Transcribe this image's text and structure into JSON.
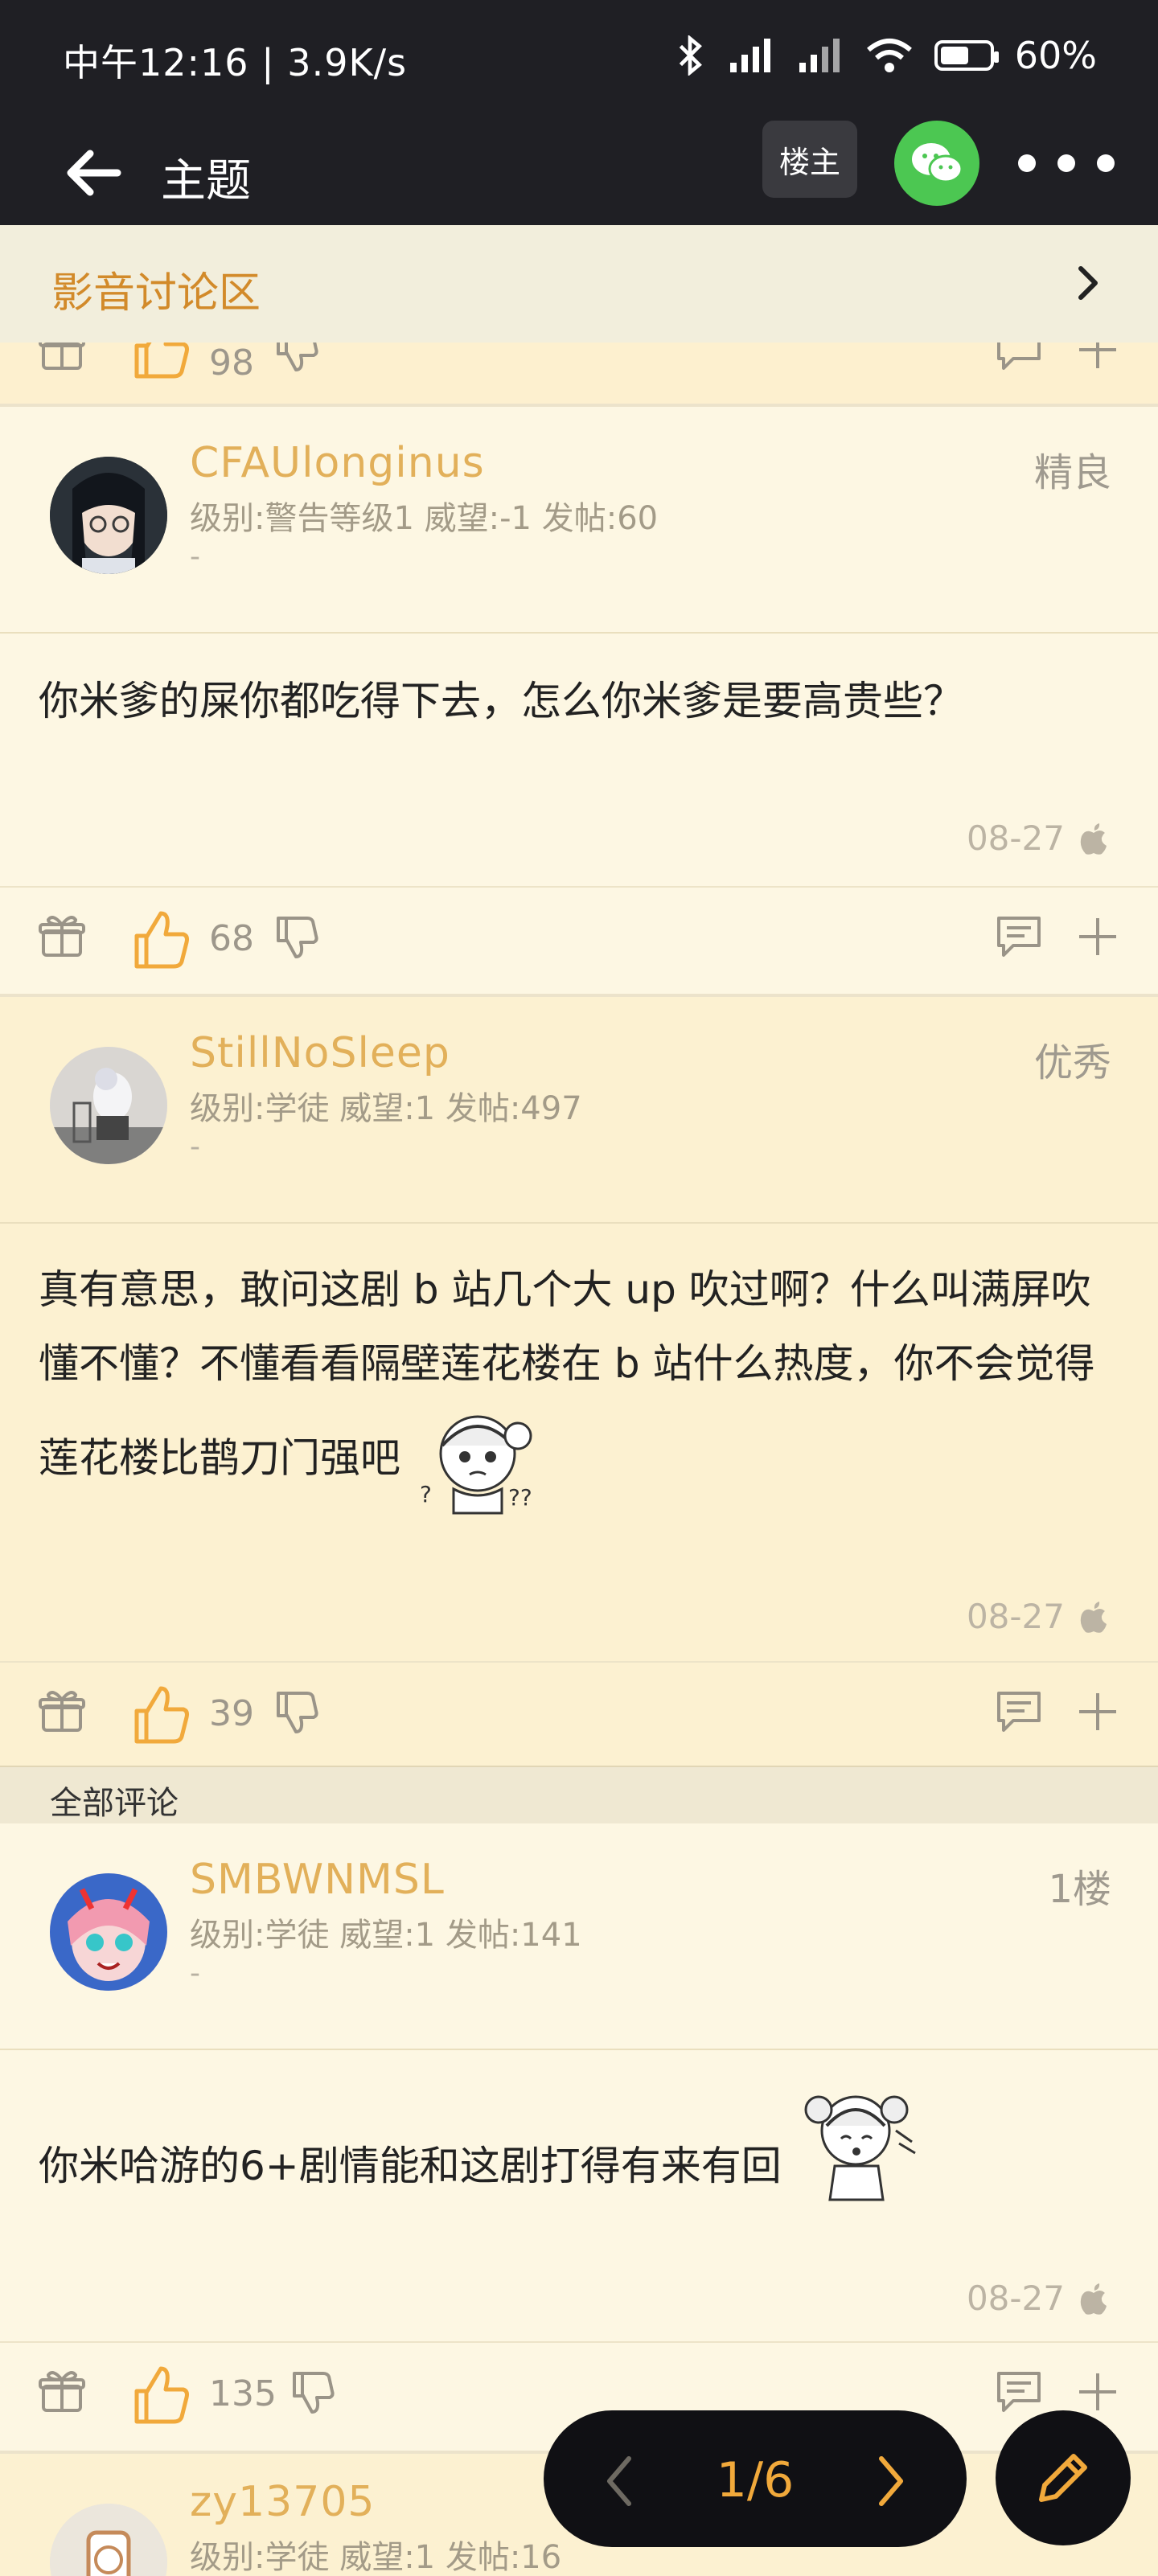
{
  "status_bar": {
    "time": "中午12:16 | 3.9K/s",
    "battery": "60%"
  },
  "header": {
    "title": "主题",
    "op_label": "楼主"
  },
  "forum": {
    "name": "影音讨论区"
  },
  "partial_top": {
    "likes": "98"
  },
  "posts": [
    {
      "username": "CFAUlonginus",
      "meta": "级别:警告等级1 威望:-1 发帖:60",
      "signature": "-",
      "badge": "精良",
      "content": "你米爹的屎你都吃得下去，怎么你米爹是要高贵些？",
      "date": "08-27",
      "likes": "68"
    },
    {
      "username": "StillNoSleep",
      "meta": "级别:学徒 威望:1 发帖:497",
      "signature": "-",
      "badge": "优秀",
      "content": "真有意思，敢问这剧 b 站几个大 up 吹过啊？什么叫满屏吹懂不懂？不懂看看隔壁莲花楼在 b 站什么热度，你不会觉得莲花楼比鹊刀门强吧",
      "date": "08-27",
      "likes": "39"
    },
    {
      "username": "SMBWNMSL",
      "meta": "级别:学徒 威望:1 发帖:141",
      "signature": "-",
      "badge": "1楼",
      "content": "你米哈游的6+剧情能和这剧打得有来有回",
      "date": "08-27",
      "likes": "135"
    },
    {
      "username": "zy13705",
      "meta": "级别:学徒 威望:1 发帖:16"
    }
  ],
  "section": {
    "label": "全部评论"
  },
  "pager": {
    "text": "1/6"
  },
  "colors": {
    "accent": "#e2b05a",
    "forum": "#d28a2a",
    "pager_text": "#f1a93b",
    "background": "#fdf7e3"
  }
}
